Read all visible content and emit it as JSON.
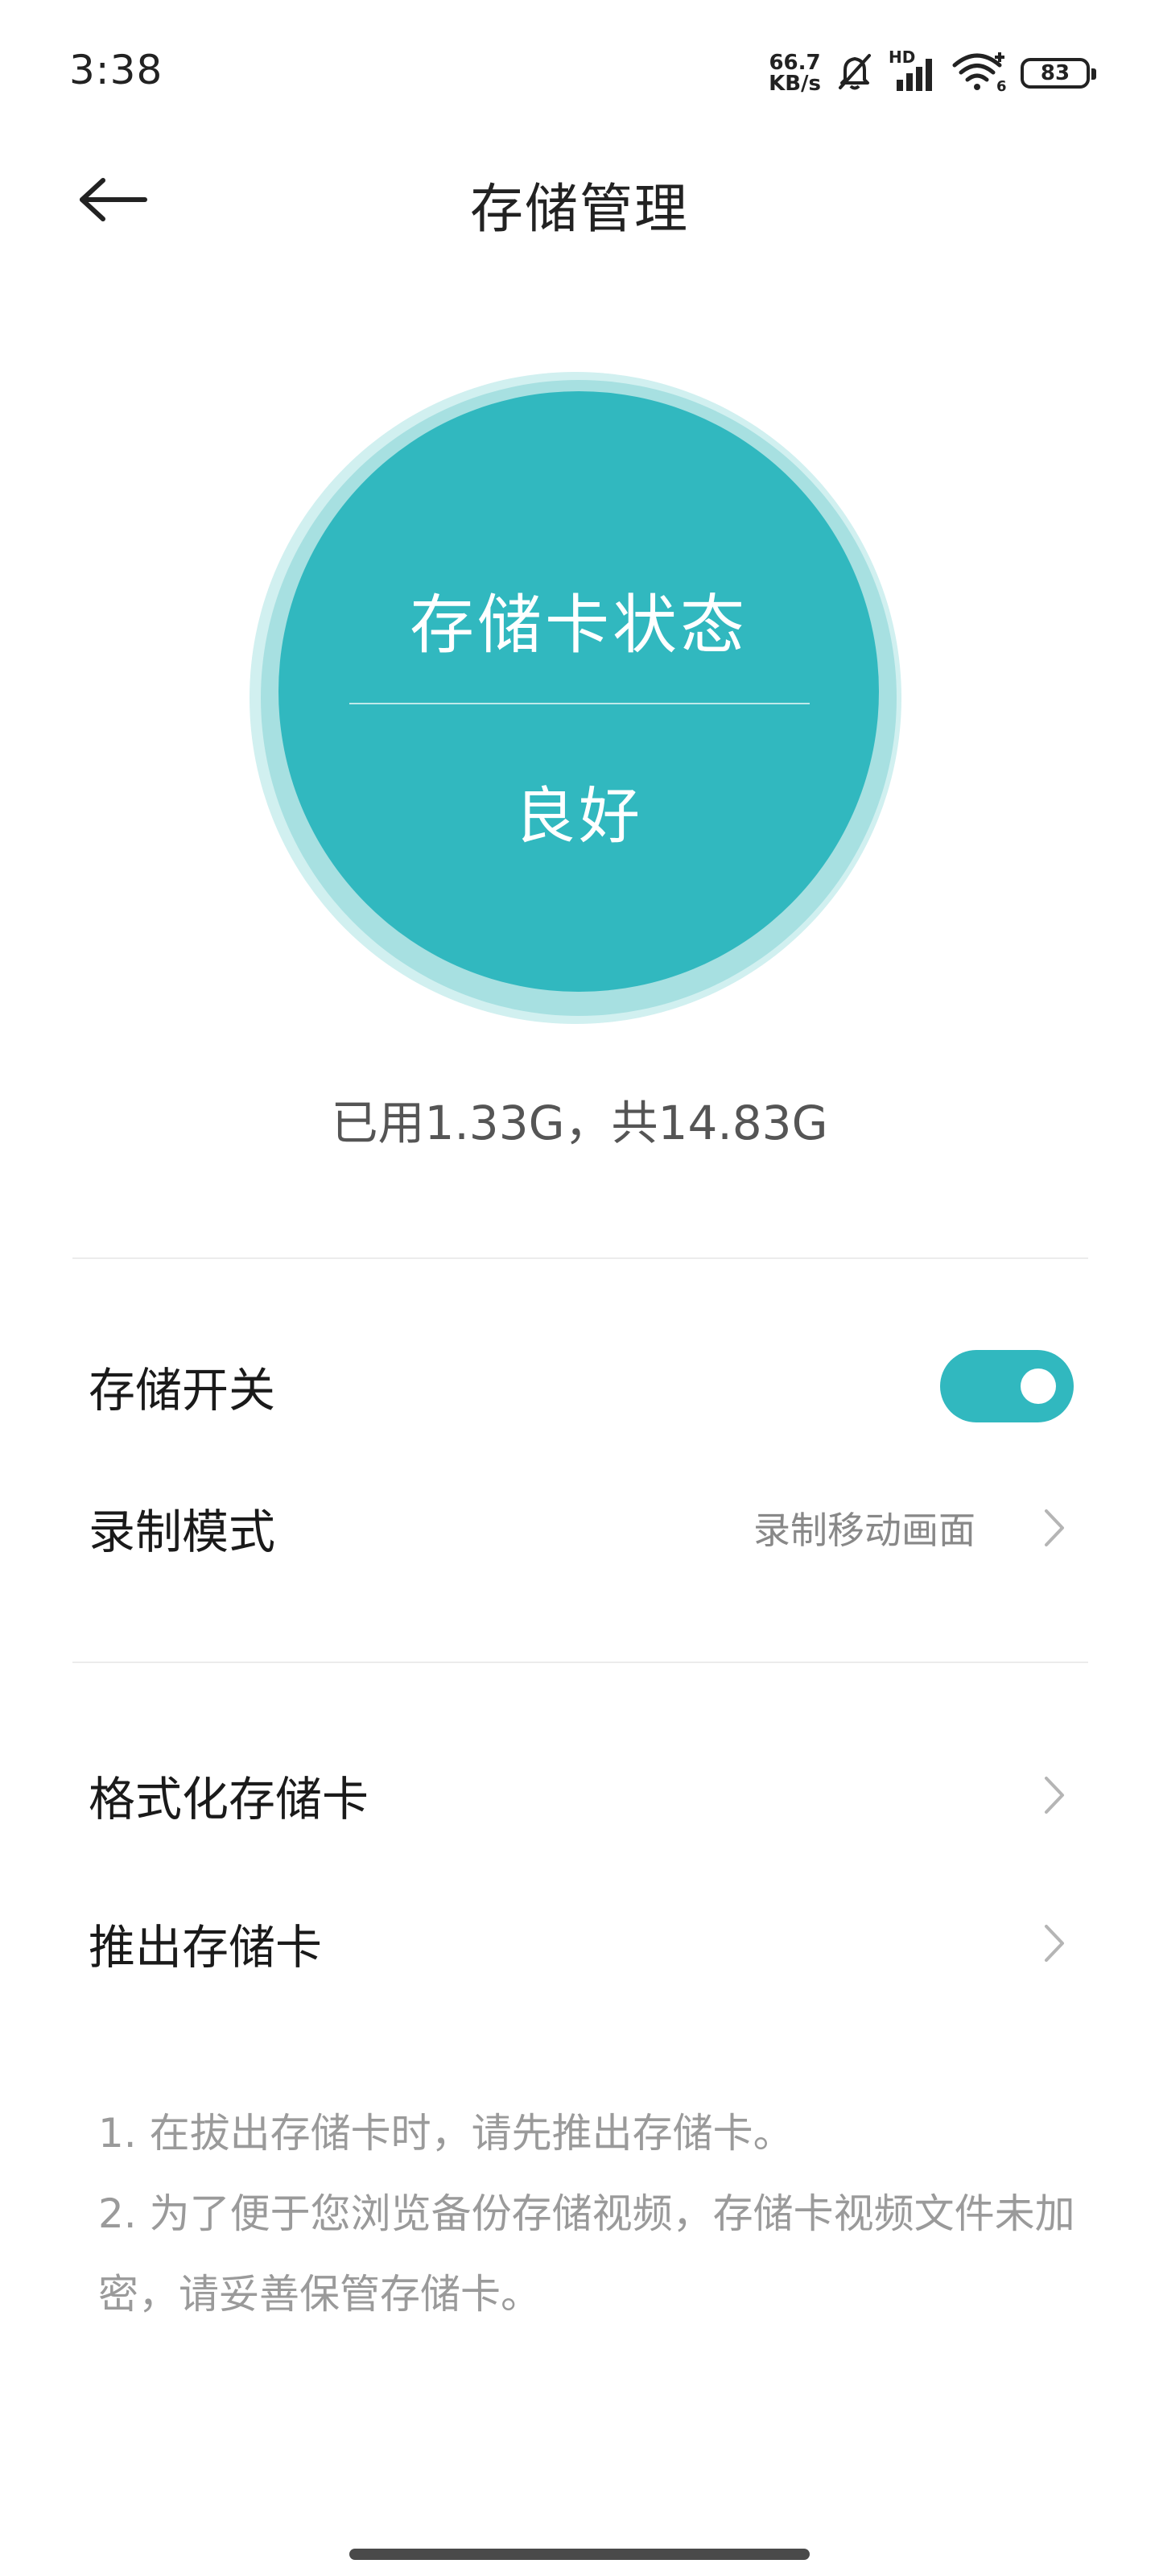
{
  "status_bar": {
    "time": "3:38",
    "net_speed_value": "66.7",
    "net_speed_unit": "KB/s",
    "signal_label": "HD",
    "battery": "83",
    "icons": [
      "mute-bell-icon",
      "cellular-signal-icon",
      "wifi-icon",
      "battery-icon"
    ]
  },
  "header": {
    "title": "存储管理",
    "back_icon": "back-arrow-icon"
  },
  "storage_status": {
    "title": "存储卡状态",
    "status": "良好",
    "usage_text": "已用1.33G，共14.83G",
    "color": "#31b8bf"
  },
  "settings": {
    "storage_switch": {
      "label": "存储开关",
      "enabled": true
    },
    "record_mode": {
      "label": "录制模式",
      "value": "录制移动画面"
    }
  },
  "actions": {
    "format": {
      "label": "格式化存储卡"
    },
    "eject": {
      "label": "推出存储卡"
    }
  },
  "notes": [
    "1. 在拔出存储卡时，请先推出存储卡。",
    "2. 为了便于您浏览备份存储视频，存储卡视频文件未加密，请妥善保管存储卡。"
  ],
  "colors": {
    "accent": "#31b8bf",
    "text_primary": "#1a1a1a",
    "text_secondary": "#888888",
    "note_text": "#9a9a9a"
  }
}
